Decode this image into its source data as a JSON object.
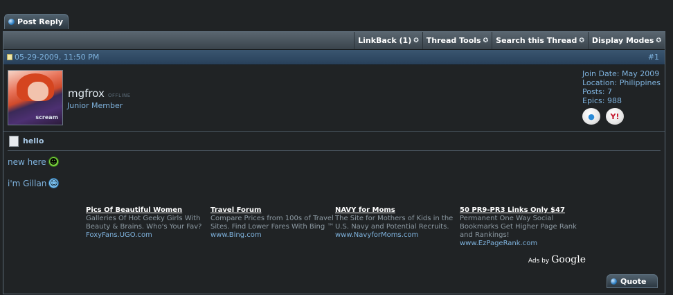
{
  "actions": {
    "post_reply": "Post Reply",
    "quote": "Quote"
  },
  "toolbar": {
    "items": [
      {
        "label": "LinkBack (1)"
      },
      {
        "label": "Thread Tools"
      },
      {
        "label": "Search this Thread"
      },
      {
        "label": "Display Modes"
      }
    ]
  },
  "post": {
    "date": "05-29-2009, 11:50 PM",
    "number": "#1",
    "title": "hello",
    "lines": [
      "new here",
      "i'm Gillan"
    ]
  },
  "user": {
    "name": "mgfrox",
    "status": "OFFLINE",
    "rank": "Junior Member",
    "avatar_text": "scream",
    "join_date": "Join Date: May 2009",
    "location": "Location: Philippines",
    "posts": "Posts: 7",
    "epics": "Epics: 988"
  },
  "ads": [
    {
      "title": "Pics Of Beautiful Women",
      "text": "Galleries Of Hot Geeky Girls With Beauty & Brains. Who's Your Fav?",
      "url": "FoxyFans.UGO.com"
    },
    {
      "title": "Travel Forum",
      "text": "Compare Prices from 100s of Travel Sites. Find Lower Fares With Bing ™",
      "url": "www.Bing.com"
    },
    {
      "title": "NAVY for Moms",
      "text": "The Site for Mothers of Kids in the U.S. Navy and Potential Recruits.",
      "url": "www.NavyforMoms.com"
    },
    {
      "title": "50 PR9-PR3 Links Only $47",
      "text": "Permanent One Way Social Bookmarks Get Higher Page Rank and Rankings!",
      "url": "www.EzPageRank.com"
    }
  ],
  "adsby": {
    "label": "Ads by",
    "brand": "Google"
  }
}
